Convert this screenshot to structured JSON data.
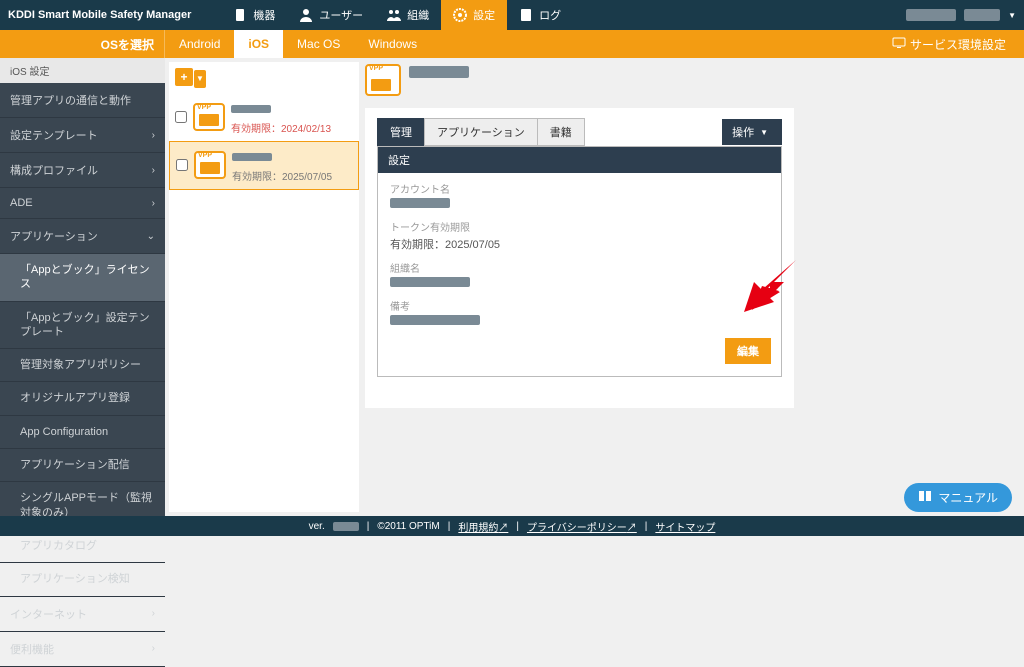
{
  "brand": "KDDI Smart Mobile Safety Manager",
  "top_tabs": [
    {
      "label": "機器"
    },
    {
      "label": "ユーザー"
    },
    {
      "label": "組織"
    },
    {
      "label": "設定",
      "active": true
    },
    {
      "label": "ログ"
    }
  ],
  "subbar": {
    "os_select": "OSを選択",
    "oses": [
      {
        "label": "Android"
      },
      {
        "label": "iOS",
        "active": true
      },
      {
        "label": "Mac OS"
      },
      {
        "label": "Windows"
      }
    ],
    "env_label": "サービス環境設定"
  },
  "side_header": "iOS 設定",
  "side_items": [
    {
      "label": "管理アプリの通信と動作",
      "chev": ""
    },
    {
      "label": "設定テンプレート",
      "chev": "›"
    },
    {
      "label": "構成プロファイル",
      "chev": "›"
    },
    {
      "label": "ADE",
      "chev": "›"
    },
    {
      "label": "アプリケーション",
      "expanded": true,
      "chev": "⌄",
      "subs": [
        {
          "label": "「Appとブック」ライセンス",
          "active": true
        },
        {
          "label": "「Appとブック」設定テンプレート"
        },
        {
          "label": "管理対象アプリポリシー"
        },
        {
          "label": "オリジナルアプリ登録"
        },
        {
          "label": "App Configuration"
        },
        {
          "label": "アプリケーション配信"
        },
        {
          "label": "シングルAPPモード（監視対象のみ）"
        },
        {
          "label": "アプリカタログ"
        },
        {
          "label": "アプリケーション検知"
        }
      ]
    },
    {
      "label": "インターネット",
      "chev": "›"
    },
    {
      "label": "便利機能",
      "chev": "›"
    }
  ],
  "certs": [
    {
      "date": "有効期限：2024/02/13",
      "expired": true
    },
    {
      "date": "有効期限：2025/07/05",
      "expired": false,
      "selected": true
    }
  ],
  "detail": {
    "tabs": [
      {
        "label": "管理",
        "active": true
      },
      {
        "label": "アプリケーション"
      },
      {
        "label": "書籍"
      }
    ],
    "ops_label": "操作",
    "body_header": "設定",
    "fields": {
      "account_label": "アカウント名",
      "token_label": "トークン有効期限",
      "token_value": "有効期限：2025/07/05",
      "org_label": "組織名",
      "note_label": "備考"
    },
    "edit_label": "編集"
  },
  "manual": "マニュアル",
  "footer": {
    "ver": "ver.",
    "copy": "©2011 OPTiM",
    "links": [
      "利用規約",
      "プライバシーポリシー",
      "サイトマップ"
    ]
  }
}
